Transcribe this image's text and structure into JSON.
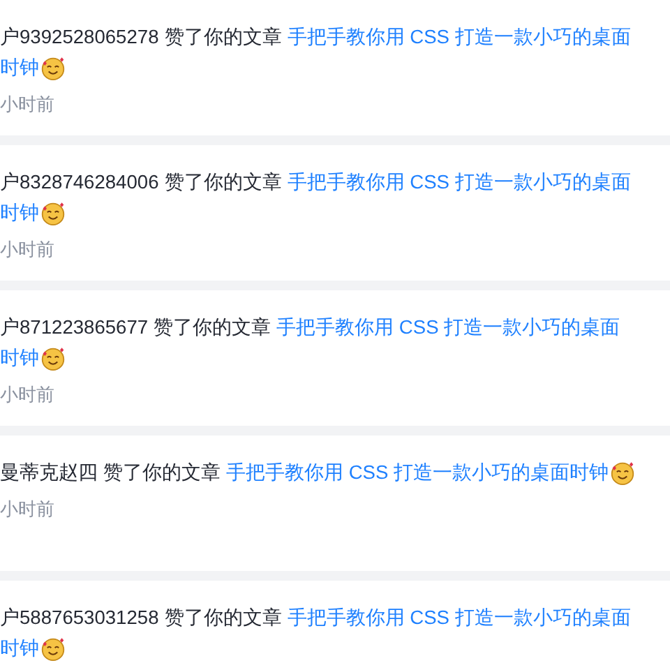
{
  "notifications": [
    {
      "user": "户9392528065278",
      "action": "赞了你的文章",
      "article_lines": [
        "手把手教你用 CSS 打造一款小巧的桌面",
        "时钟"
      ],
      "time": "小时前"
    },
    {
      "user": "户8328746284006",
      "action": "赞了你的文章",
      "article_lines": [
        "手把手教你用 CSS 打造一款小巧的桌面",
        "时钟"
      ],
      "time": "小时前"
    },
    {
      "user": "户871223865677",
      "action": "赞了你的文章",
      "article_lines": [
        "手把手教你用 CSS 打造一款小巧的桌面",
        "时钟"
      ],
      "time": "小时前"
    },
    {
      "user": "曼蒂克赵四",
      "action": "赞了你的文章",
      "article_lines": [
        "手把手教你用 CSS 打造一款小巧的桌面时钟"
      ],
      "time": "小时前"
    },
    {
      "user": "户5887653031258",
      "action": "赞了你的文章",
      "article_lines": [
        "手把手教你用 CSS 打造一款小巧的桌面",
        "时钟"
      ]
    }
  ]
}
